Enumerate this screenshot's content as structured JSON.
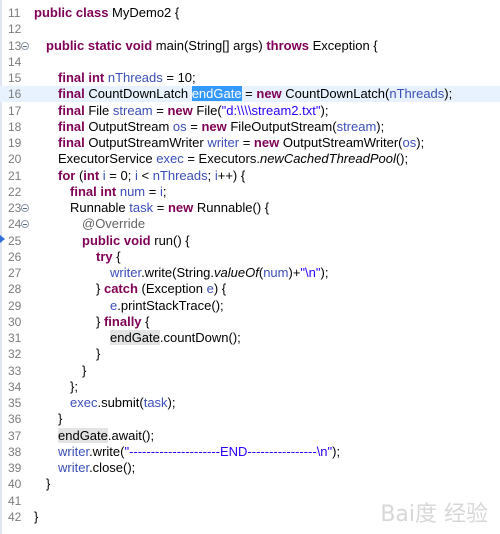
{
  "editor": {
    "lines": [
      {
        "n": "11",
        "segments": [
          {
            "t": "public class ",
            "c": "kw"
          },
          {
            "t": "MyDemo2 {",
            "c": ""
          }
        ]
      },
      {
        "n": "12",
        "segments": []
      },
      {
        "n": "13",
        "segments": [
          {
            "t": "public static void ",
            "c": "kw"
          },
          {
            "t": "main(String[] args) ",
            "c": ""
          },
          {
            "t": "throws ",
            "c": "kw"
          },
          {
            "t": "Exception {",
            "c": ""
          }
        ]
      },
      {
        "n": "14",
        "segments": []
      },
      {
        "n": "15",
        "segments": [
          {
            "t": "final int ",
            "c": "kw"
          },
          {
            "t": "nThreads",
            "c": "fld"
          },
          {
            "t": " = 10;",
            "c": ""
          }
        ]
      },
      {
        "n": "16",
        "segments": [
          {
            "t": "final ",
            "c": "kw"
          },
          {
            "t": "CountDownLatch ",
            "c": ""
          },
          {
            "t": "endGate",
            "c": "sel"
          },
          {
            "t": " = ",
            "c": ""
          },
          {
            "t": "new ",
            "c": "kw"
          },
          {
            "t": "CountDownLatch(",
            "c": ""
          },
          {
            "t": "nThreads",
            "c": "fld"
          },
          {
            "t": ");",
            "c": ""
          }
        ]
      },
      {
        "n": "17",
        "segments": [
          {
            "t": "final ",
            "c": "kw"
          },
          {
            "t": "File ",
            "c": ""
          },
          {
            "t": "stream",
            "c": "fld"
          },
          {
            "t": " = ",
            "c": ""
          },
          {
            "t": "new ",
            "c": "kw"
          },
          {
            "t": "File(",
            "c": ""
          },
          {
            "t": "\"d:\\\\\\\\stream2.txt\"",
            "c": "str"
          },
          {
            "t": ");",
            "c": ""
          }
        ]
      },
      {
        "n": "18",
        "segments": [
          {
            "t": "final ",
            "c": "kw"
          },
          {
            "t": "OutputStream ",
            "c": ""
          },
          {
            "t": "os",
            "c": "fld"
          },
          {
            "t": " = ",
            "c": ""
          },
          {
            "t": "new ",
            "c": "kw"
          },
          {
            "t": "FileOutputStream(",
            "c": ""
          },
          {
            "t": "stream",
            "c": "fld"
          },
          {
            "t": ");",
            "c": ""
          }
        ]
      },
      {
        "n": "19",
        "segments": [
          {
            "t": "final ",
            "c": "kw"
          },
          {
            "t": "OutputStreamWriter ",
            "c": ""
          },
          {
            "t": "writer",
            "c": "fld"
          },
          {
            "t": " = ",
            "c": ""
          },
          {
            "t": "new ",
            "c": "kw"
          },
          {
            "t": "OutputStreamWriter(",
            "c": ""
          },
          {
            "t": "os",
            "c": "fld"
          },
          {
            "t": ");",
            "c": ""
          }
        ]
      },
      {
        "n": "20",
        "segments": [
          {
            "t": "ExecutorService ",
            "c": ""
          },
          {
            "t": "exec",
            "c": "fld"
          },
          {
            "t": " = Executors.",
            "c": ""
          },
          {
            "t": "newCachedThreadPool",
            "c": "it"
          },
          {
            "t": "();",
            "c": ""
          }
        ]
      },
      {
        "n": "21",
        "segments": [
          {
            "t": "for ",
            "c": "kw"
          },
          {
            "t": "(",
            "c": ""
          },
          {
            "t": "int ",
            "c": "kw"
          },
          {
            "t": "i",
            "c": "fld"
          },
          {
            "t": " = 0; ",
            "c": ""
          },
          {
            "t": "i",
            "c": "fld"
          },
          {
            "t": " < ",
            "c": ""
          },
          {
            "t": "nThreads",
            "c": "fld"
          },
          {
            "t": "; ",
            "c": ""
          },
          {
            "t": "i",
            "c": "fld"
          },
          {
            "t": "++) {",
            "c": ""
          }
        ]
      },
      {
        "n": "22",
        "segments": [
          {
            "t": "final int ",
            "c": "kw"
          },
          {
            "t": "num",
            "c": "fld"
          },
          {
            "t": " = ",
            "c": ""
          },
          {
            "t": "i",
            "c": "fld"
          },
          {
            "t": ";",
            "c": ""
          }
        ]
      },
      {
        "n": "23",
        "segments": [
          {
            "t": "Runnable ",
            "c": ""
          },
          {
            "t": "task",
            "c": "fld"
          },
          {
            "t": " = ",
            "c": ""
          },
          {
            "t": "new ",
            "c": "kw"
          },
          {
            "t": "Runnable() {",
            "c": ""
          }
        ]
      },
      {
        "n": "24",
        "segments": [
          {
            "t": "@Override",
            "c": "ann"
          }
        ]
      },
      {
        "n": "25",
        "segments": [
          {
            "t": "public void ",
            "c": "kw"
          },
          {
            "t": "run() {",
            "c": ""
          }
        ]
      },
      {
        "n": "26",
        "segments": [
          {
            "t": "try ",
            "c": "kw"
          },
          {
            "t": "{",
            "c": ""
          }
        ]
      },
      {
        "n": "27",
        "segments": [
          {
            "t": "writer",
            "c": "fld"
          },
          {
            "t": ".write(String.",
            "c": ""
          },
          {
            "t": "valueOf",
            "c": "it"
          },
          {
            "t": "(",
            "c": ""
          },
          {
            "t": "num",
            "c": "fld"
          },
          {
            "t": ")+",
            "c": ""
          },
          {
            "t": "\"\\n\"",
            "c": "str"
          },
          {
            "t": ");",
            "c": ""
          }
        ]
      },
      {
        "n": "28",
        "segments": [
          {
            "t": "} ",
            "c": ""
          },
          {
            "t": "catch ",
            "c": "kw"
          },
          {
            "t": "(Exception ",
            "c": ""
          },
          {
            "t": "e",
            "c": "fld"
          },
          {
            "t": ") {",
            "c": ""
          }
        ]
      },
      {
        "n": "29",
        "segments": [
          {
            "t": "e",
            "c": "fld"
          },
          {
            "t": ".printStackTrace();",
            "c": ""
          }
        ]
      },
      {
        "n": "30",
        "segments": [
          {
            "t": "} ",
            "c": ""
          },
          {
            "t": "finally ",
            "c": "kw"
          },
          {
            "t": "{",
            "c": ""
          }
        ]
      },
      {
        "n": "31",
        "segments": [
          {
            "t": "endGate",
            "c": "occ"
          },
          {
            "t": ".countDown();",
            "c": ""
          }
        ]
      },
      {
        "n": "32",
        "segments": [
          {
            "t": "}",
            "c": ""
          }
        ]
      },
      {
        "n": "33",
        "segments": [
          {
            "t": "}",
            "c": ""
          }
        ]
      },
      {
        "n": "34",
        "segments": [
          {
            "t": "};",
            "c": ""
          }
        ]
      },
      {
        "n": "35",
        "segments": [
          {
            "t": "exec",
            "c": "fld"
          },
          {
            "t": ".submit(",
            "c": ""
          },
          {
            "t": "task",
            "c": "fld"
          },
          {
            "t": ");",
            "c": ""
          }
        ]
      },
      {
        "n": "36",
        "segments": [
          {
            "t": "}",
            "c": ""
          }
        ]
      },
      {
        "n": "37",
        "segments": [
          {
            "t": "endGate",
            "c": "occ"
          },
          {
            "t": ".await();",
            "c": ""
          }
        ]
      },
      {
        "n": "38",
        "segments": [
          {
            "t": "writer",
            "c": "fld"
          },
          {
            "t": ".write(",
            "c": ""
          },
          {
            "t": "\"---------------------END----------------\\n\"",
            "c": "str"
          },
          {
            "t": ");",
            "c": ""
          }
        ]
      },
      {
        "n": "39",
        "segments": [
          {
            "t": "writer",
            "c": "fld"
          },
          {
            "t": ".close();",
            "c": ""
          }
        ]
      },
      {
        "n": "40",
        "segments": [
          {
            "t": "}",
            "c": ""
          }
        ]
      },
      {
        "n": "41",
        "segments": []
      },
      {
        "n": "42",
        "segments": [
          {
            "t": "}",
            "c": ""
          }
        ]
      }
    ]
  },
  "watermark": "Bai度 经验"
}
